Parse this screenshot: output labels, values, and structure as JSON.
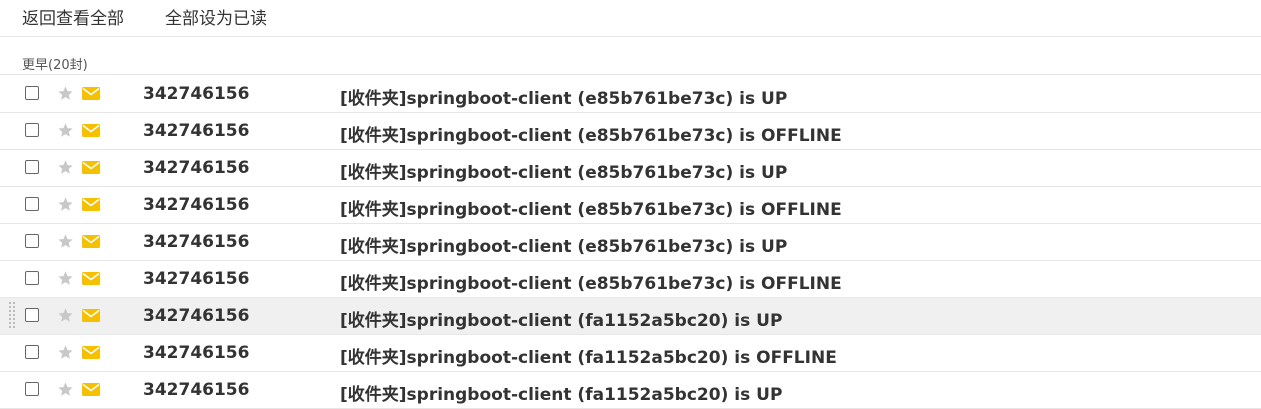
{
  "toolbar": {
    "back_label": "返回查看全部",
    "mark_read_label": "全部设为已读"
  },
  "group": {
    "label": "更早(20封)"
  },
  "colors": {
    "star": "#c8c8c8",
    "envelope": "#f5c000",
    "hover_row": "#f0f0f0"
  },
  "mails": [
    {
      "sender": "342746156",
      "subject": "[收件夹]springboot-client (e85b761be73c) is UP"
    },
    {
      "sender": "342746156",
      "subject": "[收件夹]springboot-client (e85b761be73c) is OFFLINE"
    },
    {
      "sender": "342746156",
      "subject": "[收件夹]springboot-client (e85b761be73c) is UP"
    },
    {
      "sender": "342746156",
      "subject": "[收件夹]springboot-client (e85b761be73c) is OFFLINE"
    },
    {
      "sender": "342746156",
      "subject": "[收件夹]springboot-client (e85b761be73c) is UP"
    },
    {
      "sender": "342746156",
      "subject": "[收件夹]springboot-client (e85b761be73c) is OFFLINE"
    },
    {
      "sender": "342746156",
      "subject": "[收件夹]springboot-client (fa1152a5bc20) is UP",
      "hover": true
    },
    {
      "sender": "342746156",
      "subject": "[收件夹]springboot-client (fa1152a5bc20) is OFFLINE"
    },
    {
      "sender": "342746156",
      "subject": "[收件夹]springboot-client (fa1152a5bc20) is UP"
    }
  ]
}
